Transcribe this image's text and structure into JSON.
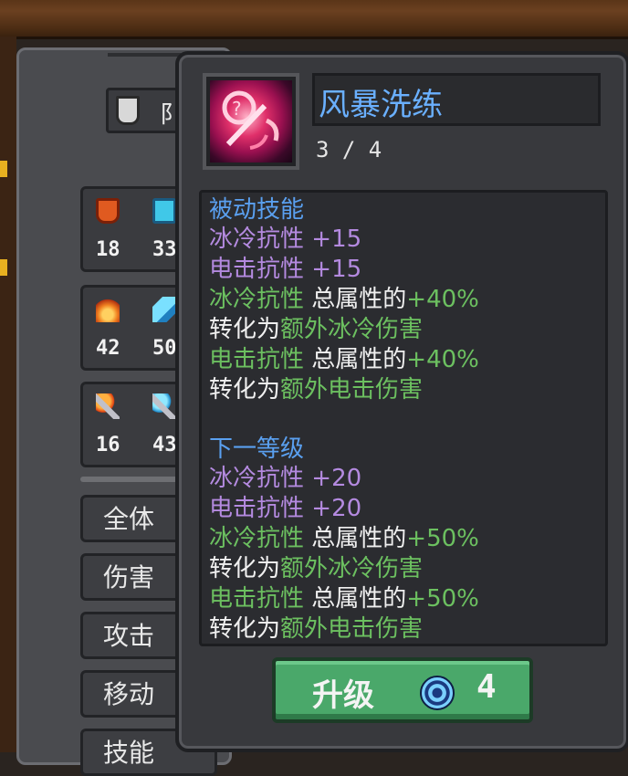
{
  "background": {
    "shield_label": "阝",
    "stats": [
      {
        "icon": "fire-shield-icon",
        "value": "18",
        "icon2": "ice-crystal-icon",
        "value2": "33"
      },
      {
        "icon": "fire-icon",
        "value": "42",
        "icon2": "ice-shard-icon",
        "value2": "50"
      },
      {
        "icon": "fire-sword-icon",
        "value": "16",
        "icon2": "ice-sword-icon",
        "value2": "43"
      }
    ],
    "menu": [
      "全体",
      "伤害",
      "攻击",
      "移动",
      "技能"
    ]
  },
  "tooltip": {
    "title": "风暴洗练",
    "level": "3 / 4",
    "current_header": "被动技能",
    "current_lines": [
      [
        {
          "t": "冰冷抗性",
          "c": "purple"
        },
        {
          "t": " +15",
          "c": "purple"
        }
      ],
      [
        {
          "t": "电击抗性",
          "c": "purple"
        },
        {
          "t": " +15",
          "c": "purple"
        }
      ],
      [
        {
          "t": "冰冷抗性",
          "c": "green"
        },
        {
          "t": " 总属性的",
          "c": "white"
        },
        {
          "t": "+40%",
          "c": "green"
        }
      ],
      [
        {
          "t": "转化为",
          "c": "white"
        },
        {
          "t": "额外冰冷伤害",
          "c": "green"
        }
      ],
      [
        {
          "t": "电击抗性",
          "c": "green"
        },
        {
          "t": " 总属性的",
          "c": "white"
        },
        {
          "t": "+40%",
          "c": "green"
        }
      ],
      [
        {
          "t": "转化为",
          "c": "white"
        },
        {
          "t": "额外电击伤害",
          "c": "green"
        }
      ]
    ],
    "next_header": "下一等级",
    "next_lines": [
      [
        {
          "t": "冰冷抗性",
          "c": "purple"
        },
        {
          "t": " +20",
          "c": "purple"
        }
      ],
      [
        {
          "t": "电击抗性",
          "c": "purple"
        },
        {
          "t": " +20",
          "c": "purple"
        }
      ],
      [
        {
          "t": "冰冷抗性",
          "c": "green"
        },
        {
          "t": " 总属性的",
          "c": "white"
        },
        {
          "t": "+50%",
          "c": "green"
        }
      ],
      [
        {
          "t": "转化为",
          "c": "white"
        },
        {
          "t": "额外冰冷伤害",
          "c": "green"
        }
      ],
      [
        {
          "t": "电击抗性",
          "c": "green"
        },
        {
          "t": " 总属性的",
          "c": "white"
        },
        {
          "t": "+50%",
          "c": "green"
        }
      ],
      [
        {
          "t": "转化为",
          "c": "white"
        },
        {
          "t": "额外电击伤害",
          "c": "green"
        }
      ]
    ],
    "upgrade_label": "升级",
    "upgrade_cost": "4",
    "cost_icon": "swirl-gem-icon"
  }
}
